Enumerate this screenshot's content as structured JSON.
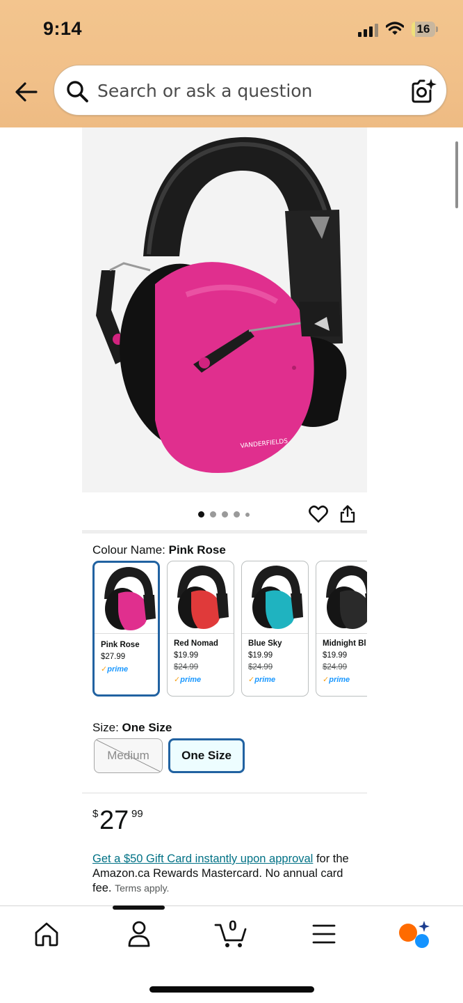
{
  "status_bar": {
    "time": "9:14",
    "battery": "16",
    "battery_level": 0.16
  },
  "search": {
    "placeholder": "Search or ask a question"
  },
  "product": {
    "image_dots": {
      "total": 5,
      "active_index": 0
    },
    "brand_mark": "VANDERFIELDS"
  },
  "colour": {
    "label": "Colour Name: ",
    "selected": "Pink Rose",
    "options": [
      {
        "name": "Pink Rose",
        "price": "$27.99",
        "list_price": "",
        "prime": "prime",
        "cup_color": "#e02f8e"
      },
      {
        "name": "Red Nomad",
        "price": "$19.99",
        "list_price": "$24.99",
        "prime": "prime",
        "cup_color": "#e03a3a"
      },
      {
        "name": "Blue Sky",
        "price": "$19.99",
        "list_price": "$24.99",
        "prime": "prime",
        "cup_color": "#1fb3c0"
      },
      {
        "name": "Midnight Bl",
        "price": "$19.99",
        "list_price": "$24.99",
        "prime": "prime",
        "cup_color": "#2a2a2a"
      }
    ]
  },
  "size": {
    "label": "Size: ",
    "selected": "One Size",
    "options": [
      {
        "label": "Medium",
        "available": false
      },
      {
        "label": "One Size",
        "available": true
      }
    ]
  },
  "price": {
    "symbol": "$",
    "whole": "27",
    "fraction": "99"
  },
  "promo": {
    "link": "Get a $50 Gift Card instantly upon approval",
    "text": " for the Amazon.ca Rewards Mastercard. No annual card fee. ",
    "terms": "Terms apply."
  },
  "bottom_nav": {
    "cart_count": "0"
  },
  "colors": {
    "accent_selected": "#2162a1",
    "link": "#007185",
    "prime": "#1a98ff"
  }
}
